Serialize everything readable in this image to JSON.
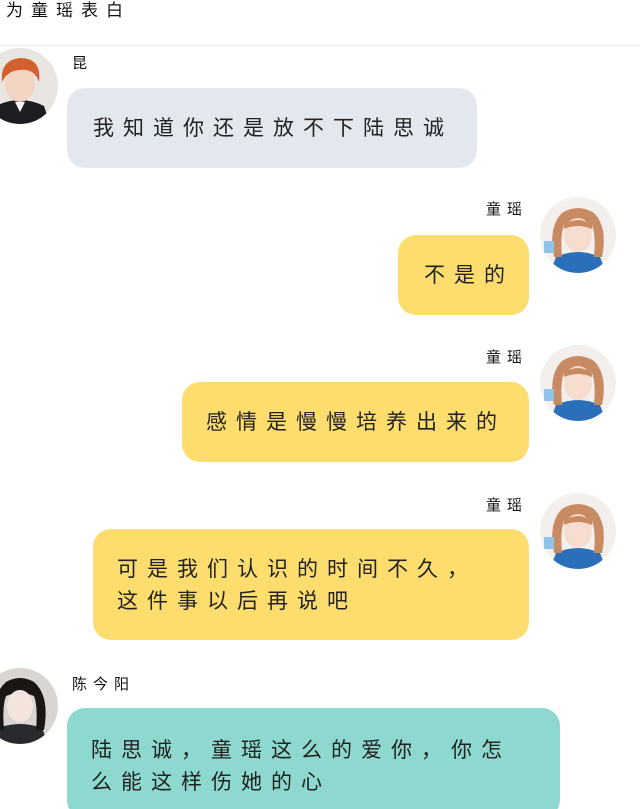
{
  "title": "为童瑶表白",
  "messages": [
    {
      "sender": "昆",
      "side": "left",
      "color": "gray",
      "lines": [
        "我知道你还是放不下陆思诚"
      ]
    },
    {
      "sender": "童瑶",
      "side": "right",
      "color": "yellow",
      "lines": [
        "不是的"
      ]
    },
    {
      "sender": "童瑶",
      "side": "right",
      "color": "yellow",
      "lines": [
        "感情是慢慢培养出来的"
      ]
    },
    {
      "sender": "童瑶",
      "side": "right",
      "color": "yellow",
      "lines": [
        "可是我们认识的时间不久，",
        "这件事以后再说吧"
      ]
    },
    {
      "sender": "陈今阳",
      "side": "left",
      "color": "teal",
      "lines": [
        "陆思诚，童瑶这么的爱你，你怎",
        "么能这样伤她的心"
      ]
    }
  ],
  "colors": {
    "gray_bubble": "#e3e8ee",
    "yellow_bubble": "#fcdd6e",
    "teal_bubble": "#8dd9cf"
  },
  "icons": {
    "avatar_1": "male-portrait-avatar",
    "avatar_2": "female-portrait-avatar",
    "avatar_3": "female-portrait-avatar-dark"
  }
}
